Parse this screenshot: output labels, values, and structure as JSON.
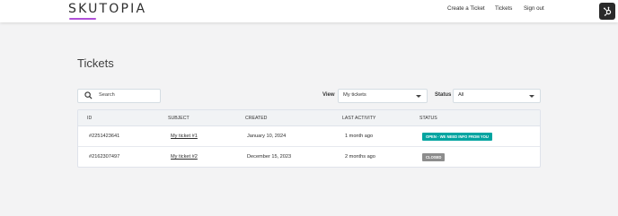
{
  "header": {
    "logo": "SKUTOPIA",
    "accent": "#b04fd9",
    "nav": {
      "create_ticket": "Create a Ticket",
      "tickets": "Tickets",
      "sign_out": "Sign out"
    },
    "badge_icon": "hubspot-icon"
  },
  "page": {
    "title": "Tickets"
  },
  "filters": {
    "search_placeholder": "Search",
    "view_label": "View",
    "view_value": "My tickets",
    "status_label": "Status",
    "status_value": "All"
  },
  "table": {
    "columns": [
      "ID",
      "SUBJECT",
      "CREATED",
      "LAST ACTIVITY",
      "STATUS"
    ],
    "rows": [
      {
        "id": "#2251423641",
        "subject": "My ticket #1",
        "created": "January 10, 2024",
        "last_activity": "1 month ago",
        "status": "OPEN - WE NEED INFO FROM YOU",
        "status_color": "#00a4a0"
      },
      {
        "id": "#2162307497",
        "subject": "My ticket #2",
        "created": "December 15, 2023",
        "last_activity": "2 months ago",
        "status": "CLOSED",
        "status_color": "#8c8c8c"
      }
    ]
  }
}
